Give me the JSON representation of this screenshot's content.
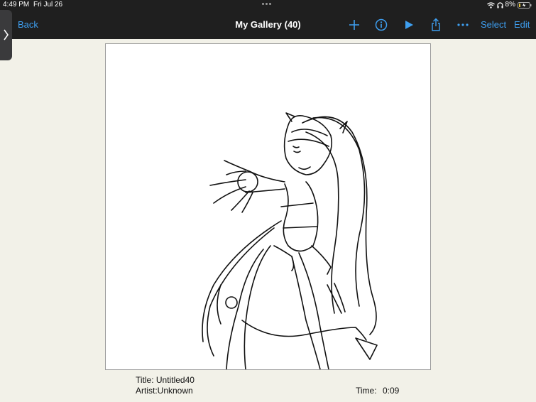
{
  "status": {
    "time": "4:49 PM",
    "date": "Fri Jul 26",
    "battery": "8%"
  },
  "nav": {
    "back": "Back",
    "title": "My Gallery (40)",
    "select": "Select",
    "edit": "Edit"
  },
  "icons": [
    "chevron-right-icon",
    "plus-icon",
    "info-icon",
    "play-icon",
    "share-icon",
    "more-icon",
    "wifi-icon",
    "headphones-icon",
    "battery-icon"
  ],
  "artwork": {
    "title_label": "Title: Untitled40",
    "artist_label": "Artist:Unknown",
    "time_label": "Time:",
    "time_value": "0:09"
  },
  "colors": {
    "accent": "#3e9ff0",
    "bar": "#1f1f1f",
    "background": "#f2f1e8"
  }
}
